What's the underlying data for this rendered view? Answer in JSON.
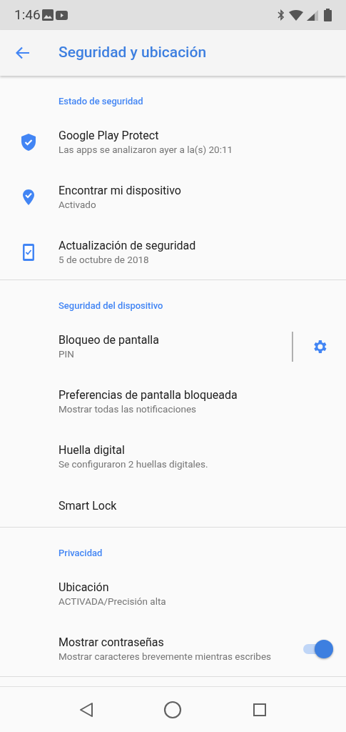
{
  "status_bar": {
    "time": "1:46"
  },
  "app_bar": {
    "title": "Seguridad y ubicación"
  },
  "sections": [
    {
      "header": "Estado de seguridad",
      "items": [
        {
          "kind": "icon",
          "title": "Google Play Protect",
          "subtitle": "Las apps se analizaron ayer a la(s) 20:11"
        },
        {
          "kind": "icon",
          "title": "Encontrar mi dispositivo",
          "subtitle": "Activado"
        },
        {
          "kind": "icon",
          "title": "Actualización de seguridad",
          "subtitle": "5 de octubre de 2018"
        }
      ]
    },
    {
      "header": "Seguridad del dispositivo",
      "items": [
        {
          "kind": "gear",
          "title": "Bloqueo de pantalla",
          "subtitle": "PIN"
        },
        {
          "kind": "plain",
          "title": "Preferencias de pantalla bloqueada",
          "subtitle": "Mostrar todas las notificaciones"
        },
        {
          "kind": "plain",
          "title": "Huella digital",
          "subtitle": "Se configuraron 2 huellas digitales."
        },
        {
          "kind": "plain",
          "title": "Smart Lock"
        }
      ]
    },
    {
      "header": "Privacidad",
      "items": [
        {
          "kind": "plain",
          "title": "Ubicación",
          "subtitle": "ACTIVADA/Precisión alta"
        },
        {
          "kind": "switch",
          "title": "Mostrar contraseñas",
          "subtitle": "Mostrar caracteres brevemente mientras escribes",
          "on": true
        }
      ]
    }
  ]
}
